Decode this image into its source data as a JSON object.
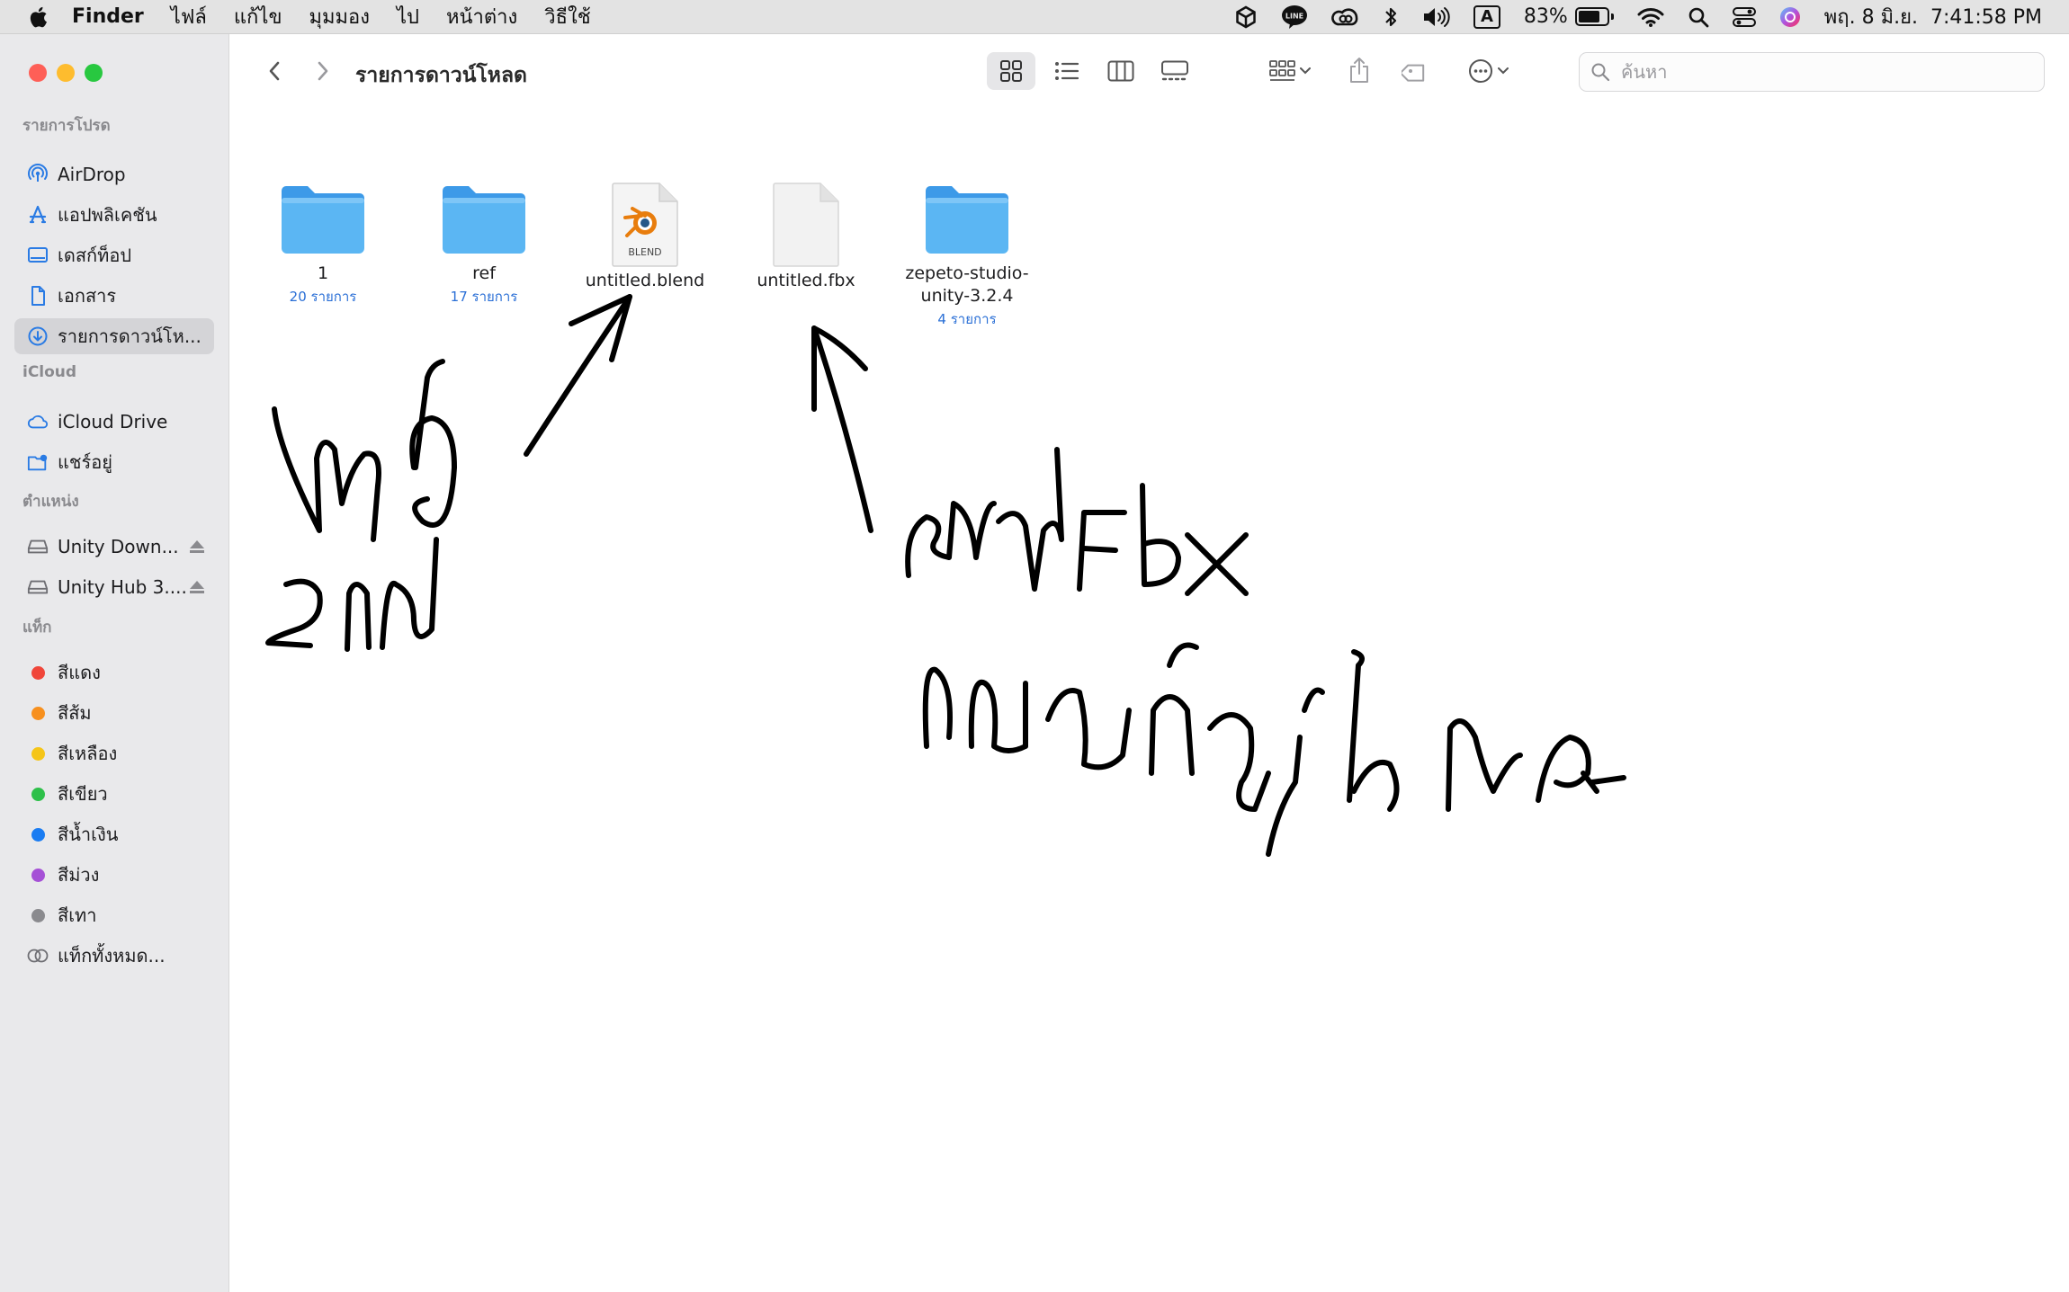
{
  "menubar": {
    "app_name": "Finder",
    "menus": [
      "ไฟล์",
      "แก้ไข",
      "มุมมอง",
      "ไป",
      "หน้าต่าง",
      "วิธีใช้"
    ],
    "input_source": "A",
    "battery_percent": "83%",
    "battery_level": 0.83,
    "datetime": "พฤ. 8 มิ.ย.  7:41:58 PM"
  },
  "window": {
    "title": "รายการดาวน์โหลด",
    "search_placeholder": "ค้นหา"
  },
  "sidebar": {
    "favorites_header": "รายการโปรด",
    "favorites": [
      {
        "label": "AirDrop",
        "icon": "airdrop-icon"
      },
      {
        "label": "แอปพลิเคชัน",
        "icon": "applications-icon"
      },
      {
        "label": "เดสก์ท็อป",
        "icon": "desktop-icon"
      },
      {
        "label": "เอกสาร",
        "icon": "document-icon"
      },
      {
        "label": "รายการดาวน์โห...",
        "icon": "downloads-icon",
        "selected": true
      }
    ],
    "icloud_header": "iCloud",
    "icloud": [
      {
        "label": "iCloud Drive",
        "icon": "icloud-icon"
      },
      {
        "label": "แชร์อยู่",
        "icon": "shared-folder-icon"
      }
    ],
    "locations_header": "ตำแหน่ง",
    "locations": [
      {
        "label": "Unity Down...",
        "icon": "disk-icon"
      },
      {
        "label": "Unity Hub 3....",
        "icon": "disk-icon"
      }
    ],
    "tags_header": "แท็ก",
    "tags": [
      {
        "label": "สีแดง",
        "color": "#f0463a"
      },
      {
        "label": "สีส้ม",
        "color": "#f7901e"
      },
      {
        "label": "สีเหลือง",
        "color": "#f5c518"
      },
      {
        "label": "สีเขียว",
        "color": "#2ec04a"
      },
      {
        "label": "สีน้ำเงิน",
        "color": "#1a7cf2"
      },
      {
        "label": "สีม่วง",
        "color": "#a550d6"
      },
      {
        "label": "สีเทา",
        "color": "#8a8a8e"
      }
    ],
    "all_tags": "แท็กทั้งหมด..."
  },
  "files": [
    {
      "name": "1",
      "count": "20 รายการ",
      "kind": "folder"
    },
    {
      "name": "ref",
      "count": "17 รายการ",
      "kind": "folder"
    },
    {
      "name": "untitled.blend",
      "kind": "blend",
      "badge": "BLEND"
    },
    {
      "name": "untitled.fbx",
      "kind": "document"
    },
    {
      "name": "zepeto-studio-\nunity-3.2.4",
      "count": "4 รายการ",
      "kind": "folder"
    }
  ],
  "colors": {
    "accent": "#2a6fd6",
    "folder": "#5bb6f3",
    "traffic_red": "#fe5f57",
    "traffic_yellow": "#febc2e",
    "traffic_green": "#28c840"
  }
}
